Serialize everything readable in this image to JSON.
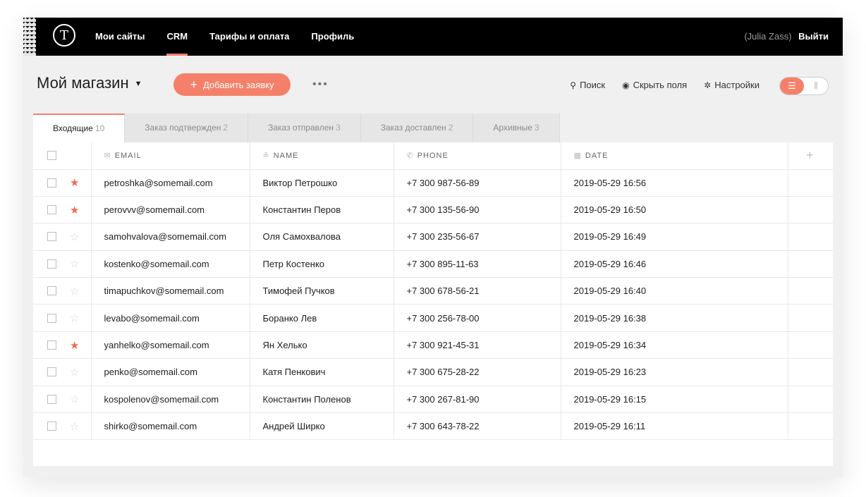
{
  "nav": {
    "logo": "T",
    "items": [
      {
        "label": "Мои сайты",
        "active": false
      },
      {
        "label": "CRM",
        "active": true
      },
      {
        "label": "Тарифы и оплата",
        "active": false
      },
      {
        "label": "Профиль",
        "active": false
      }
    ],
    "user": "(Julia Zass)",
    "logout": "Выйти"
  },
  "toolbar": {
    "title": "Мой магазин",
    "add_button": "Добавить заявку",
    "more": "•••",
    "links": [
      {
        "icon": "search-icon",
        "glyph": "⚲",
        "label": "Поиск"
      },
      {
        "icon": "eye-icon",
        "glyph": "◉",
        "label": "Скрыть поля"
      },
      {
        "icon": "gear-icon",
        "glyph": "✲",
        "label": "Настройки"
      }
    ]
  },
  "tabs": [
    {
      "label": "Входящие",
      "count": "10",
      "active": true
    },
    {
      "label": "Заказ подтвержден",
      "count": "2",
      "active": false
    },
    {
      "label": "Заказ отправлен",
      "count": "3",
      "active": false
    },
    {
      "label": "Заказ доставлен",
      "count": "2",
      "active": false
    },
    {
      "label": "Архивные",
      "count": "3",
      "active": false
    }
  ],
  "table": {
    "columns": [
      {
        "key": "email",
        "label": "EMAIL",
        "icon": "mail-icon",
        "glyph": "✉"
      },
      {
        "key": "name",
        "label": "NAME",
        "icon": "person-icon",
        "glyph": "≗"
      },
      {
        "key": "phone",
        "label": "PHONE",
        "icon": "phone-icon",
        "glyph": "✆"
      },
      {
        "key": "date",
        "label": "DATE",
        "icon": "calendar-icon",
        "glyph": "▦"
      }
    ],
    "add_column": "+",
    "rows": [
      {
        "starred": true,
        "email": "petroshka@somemail.com",
        "name": "Виктор Петрошко",
        "phone": "+7 300 987-56-89",
        "date": "2019-05-29 16:56"
      },
      {
        "starred": true,
        "email": "perovvv@somemail.com",
        "name": "Константин Перов",
        "phone": "+7 300 135-56-90",
        "date": "2019-05-29 16:50"
      },
      {
        "starred": false,
        "email": "samohvalova@somemail.com",
        "name": "Оля Самохвалова",
        "phone": "+7 300 235-56-67",
        "date": "2019-05-29 16:49"
      },
      {
        "starred": false,
        "email": "kostenko@somemail.com",
        "name": "Петр Костенко",
        "phone": "+7 300 895-11-63",
        "date": "2019-05-29 16:46"
      },
      {
        "starred": false,
        "email": "timapuchkov@somemail.com",
        "name": "Тимофей Пучков",
        "phone": "+7 300 678-56-21",
        "date": "2019-05-29 16:40"
      },
      {
        "starred": false,
        "email": "levabo@somemail.com",
        "name": "Боранко Лев",
        "phone": "+7 300 256-78-00",
        "date": "2019-05-29 16:38"
      },
      {
        "starred": true,
        "email": "yanhelko@somemail.com",
        "name": "Ян Хелько",
        "phone": "+7 300 921-45-31",
        "date": "2019-05-29 16:34"
      },
      {
        "starred": false,
        "email": "penko@somemail.com",
        "name": "Катя Пенкович",
        "phone": "+7 300 675-28-22",
        "date": "2019-05-29 16:23"
      },
      {
        "starred": false,
        "email": "kospolenov@somemail.com",
        "name": "Константин Поленов",
        "phone": "+7 300 267-81-90",
        "date": "2019-05-29 16:15"
      },
      {
        "starred": false,
        "email": "shirko@somemail.com",
        "name": "Андрей Ширко",
        "phone": "+7 300 643-78-22",
        "date": "2019-05-29 16:11"
      }
    ]
  },
  "colors": {
    "accent": "#f4806a",
    "star": "#ee6a4e",
    "nav_bg": "#000000"
  }
}
